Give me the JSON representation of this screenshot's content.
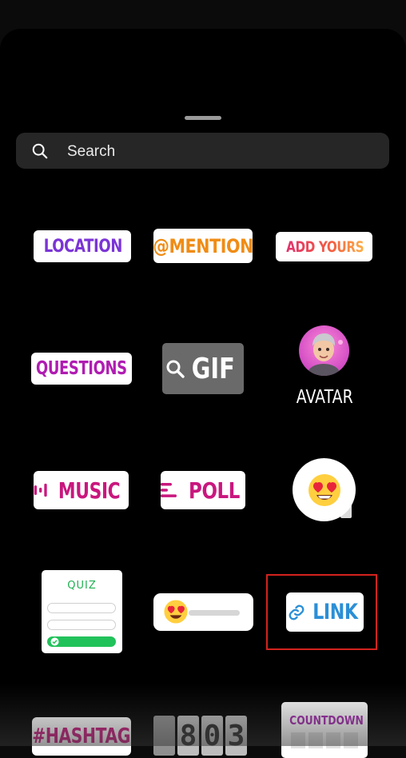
{
  "search": {
    "placeholder": "Search"
  },
  "stickers": {
    "location": "LOCATION",
    "mention": "@MENTION",
    "add_yours": "ADD YOURS",
    "questions": "QUESTIONS",
    "gif": "GIF",
    "avatar": "AVATAR",
    "music": "MUSIC",
    "poll": "POLL",
    "quiz": "QUIZ",
    "link": "LINK",
    "hashtag": "#HASHTAG",
    "countdown": "COUNTDOWN"
  },
  "counter": {
    "digits": [
      "",
      "8",
      "0",
      "3"
    ]
  },
  "colors": {
    "location": "#7b34d6",
    "mention": "#f08c15",
    "questions": "#b01cb2",
    "music": "#c9177e",
    "link": "#2b8fd6",
    "quiz": "#20b052",
    "highlight": "#d3221e"
  },
  "icons": {
    "search": "search-icon",
    "location": "location-pin-icon",
    "add_yours": "camera-icon",
    "gif": "magnifier-icon",
    "music": "music-bars-icon",
    "poll": "poll-lines-icon",
    "link": "link-chain-icon",
    "emoji": "heart-eyes-emoji-icon"
  },
  "highlight": {
    "target": "link"
  }
}
